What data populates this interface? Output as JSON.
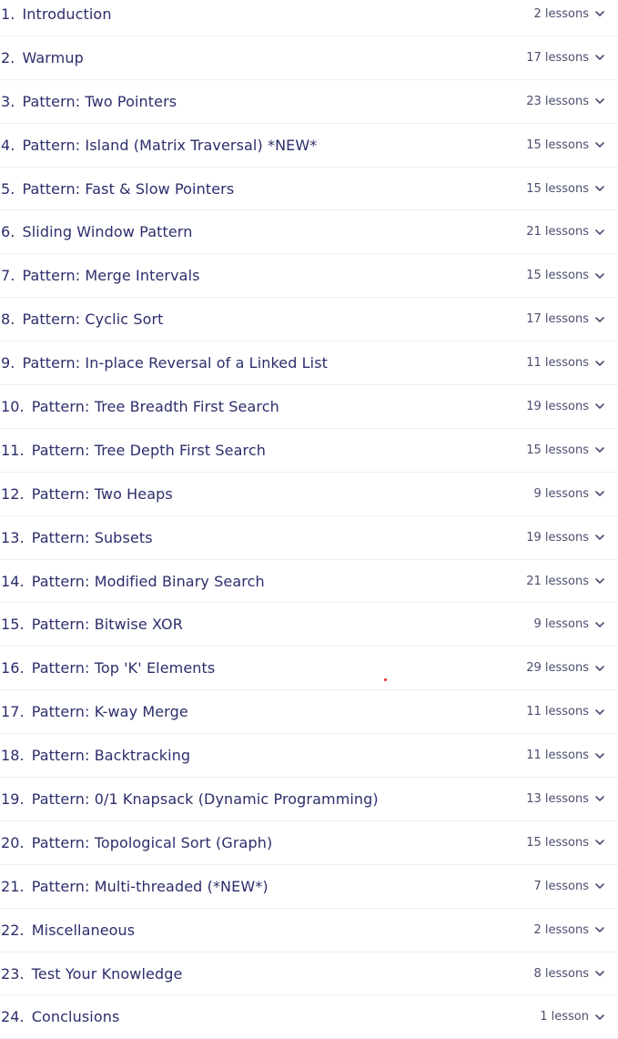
{
  "modules": [
    {
      "number": "1.",
      "title": "Introduction",
      "lessons": "2 lessons"
    },
    {
      "number": "2.",
      "title": "Warmup",
      "lessons": "17 lessons"
    },
    {
      "number": "3.",
      "title": "Pattern: Two Pointers",
      "lessons": "23 lessons"
    },
    {
      "number": "4.",
      "title": "Pattern: Island (Matrix Traversal) *NEW*",
      "lessons": "15 lessons"
    },
    {
      "number": "5.",
      "title": "Pattern: Fast & Slow Pointers",
      "lessons": "15 lessons"
    },
    {
      "number": "6.",
      "title": "Sliding Window Pattern",
      "lessons": "21 lessons"
    },
    {
      "number": "7.",
      "title": "Pattern: Merge Intervals",
      "lessons": "15 lessons"
    },
    {
      "number": "8.",
      "title": "Pattern: Cyclic Sort",
      "lessons": "17 lessons"
    },
    {
      "number": "9.",
      "title": "Pattern: In-place Reversal of a Linked List",
      "lessons": "11 lessons"
    },
    {
      "number": "10.",
      "title": "Pattern: Tree Breadth First Search",
      "lessons": "19 lessons"
    },
    {
      "number": "11.",
      "title": "Pattern: Tree Depth First Search",
      "lessons": "15 lessons"
    },
    {
      "number": "12.",
      "title": "Pattern: Two Heaps",
      "lessons": "9 lessons"
    },
    {
      "number": "13.",
      "title": "Pattern: Subsets",
      "lessons": "19 lessons"
    },
    {
      "number": "14.",
      "title": "Pattern: Modified Binary Search",
      "lessons": "21 lessons"
    },
    {
      "number": "15.",
      "title": "Pattern: Bitwise XOR",
      "lessons": "9 lessons"
    },
    {
      "number": "16.",
      "title": "Pattern: Top 'K' Elements",
      "lessons": "29 lessons"
    },
    {
      "number": "17.",
      "title": "Pattern: K-way Merge",
      "lessons": "11 lessons"
    },
    {
      "number": "18.",
      "title": "Pattern: Backtracking",
      "lessons": "11 lessons"
    },
    {
      "number": "19.",
      "title": "Pattern: 0/1 Knapsack (Dynamic Programming)",
      "lessons": "13 lessons"
    },
    {
      "number": "20.",
      "title": "Pattern: Topological Sort (Graph)",
      "lessons": "15 lessons"
    },
    {
      "number": "21.",
      "title": "Pattern: Multi-threaded (*NEW*)",
      "lessons": "7 lessons"
    },
    {
      "number": "22.",
      "title": "Miscellaneous",
      "lessons": "2 lessons"
    },
    {
      "number": "23.",
      "title": "Test Your Knowledge",
      "lessons": "8 lessons"
    },
    {
      "number": "24.",
      "title": "Conclusions",
      "lessons": "1 lesson"
    }
  ],
  "icons": {
    "expand": "chevron-down-icon"
  },
  "colors": {
    "text": "#2b2e6b",
    "muted": "#4b4f6f",
    "divider": "#eeeeef",
    "dot": "#e0222a"
  }
}
